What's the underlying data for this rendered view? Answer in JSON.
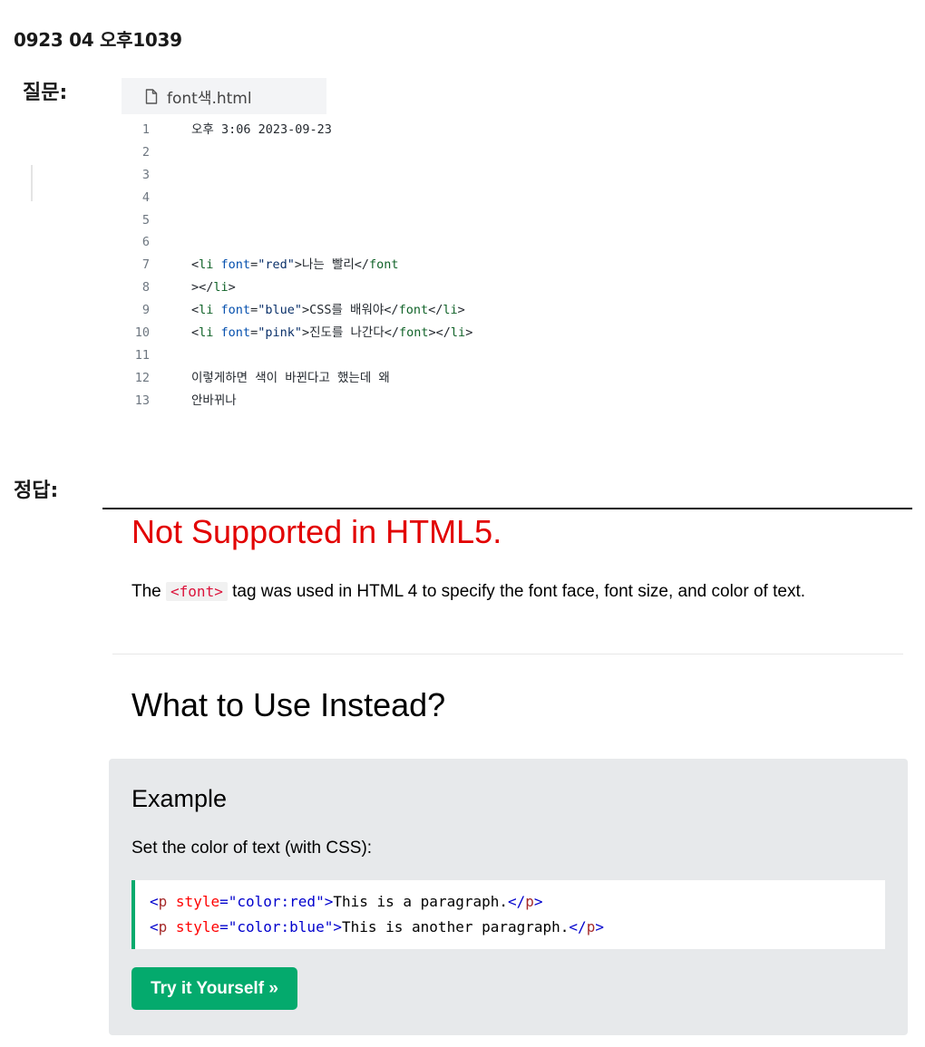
{
  "header": {
    "title": "0923 04 오후1039"
  },
  "question": {
    "label": "질문:"
  },
  "answer": {
    "label": "정답:"
  },
  "file": {
    "icon": "file-icon",
    "name": "font색.html",
    "lines": [
      {
        "num": "1",
        "tokens": [
          {
            "t": "txt",
            "v": "오후 3:06 2023-09-23"
          }
        ]
      },
      {
        "num": "2",
        "tokens": []
      },
      {
        "num": "3",
        "tokens": []
      },
      {
        "num": "4",
        "tokens": []
      },
      {
        "num": "5",
        "tokens": []
      },
      {
        "num": "6",
        "tokens": []
      },
      {
        "num": "7",
        "tokens": [
          {
            "t": "txt",
            "v": "<"
          },
          {
            "t": "tag",
            "v": "li"
          },
          {
            "t": "txt",
            "v": " "
          },
          {
            "t": "attr",
            "v": "font"
          },
          {
            "t": "txt",
            "v": "="
          },
          {
            "t": "str",
            "v": "\"red\""
          },
          {
            "t": "txt",
            "v": ">나는 빨리</"
          },
          {
            "t": "tag",
            "v": "font"
          }
        ]
      },
      {
        "num": "8",
        "tokens": [
          {
            "t": "txt",
            "v": "></"
          },
          {
            "t": "tag",
            "v": "li"
          },
          {
            "t": "txt",
            "v": ">"
          }
        ]
      },
      {
        "num": "9",
        "tokens": [
          {
            "t": "txt",
            "v": "<"
          },
          {
            "t": "tag",
            "v": "li"
          },
          {
            "t": "txt",
            "v": " "
          },
          {
            "t": "attr",
            "v": "font"
          },
          {
            "t": "txt",
            "v": "="
          },
          {
            "t": "str",
            "v": "\"blue\""
          },
          {
            "t": "txt",
            "v": ">CSS를 배워야</"
          },
          {
            "t": "tag",
            "v": "font"
          },
          {
            "t": "txt",
            "v": "</"
          },
          {
            "t": "tag",
            "v": "li"
          },
          {
            "t": "txt",
            "v": ">"
          }
        ]
      },
      {
        "num": "10",
        "tokens": [
          {
            "t": "txt",
            "v": "<"
          },
          {
            "t": "tag",
            "v": "li"
          },
          {
            "t": "txt",
            "v": " "
          },
          {
            "t": "attr",
            "v": "font"
          },
          {
            "t": "txt",
            "v": "="
          },
          {
            "t": "str",
            "v": "\"pink\""
          },
          {
            "t": "txt",
            "v": ">진도를 나간다</"
          },
          {
            "t": "tag",
            "v": "font"
          },
          {
            "t": "txt",
            "v": "></"
          },
          {
            "t": "tag",
            "v": "li"
          },
          {
            "t": "txt",
            "v": ">"
          }
        ]
      },
      {
        "num": "11",
        "tokens": []
      },
      {
        "num": "12",
        "tokens": [
          {
            "t": "txt",
            "v": "이렇게하면 색이 바뀐다고 했는데 왜"
          }
        ]
      },
      {
        "num": "13",
        "tokens": [
          {
            "t": "txt",
            "v": "안바뀌나"
          }
        ]
      }
    ]
  },
  "w3": {
    "not_supported": "Not Supported in HTML5.",
    "intro_before": "The ",
    "intro_code": "<font>",
    "intro_after": " tag was used in HTML 4 to specify the font face, font size, and color of text.",
    "instead_title": "What to Use Instead?",
    "example_title": "Example",
    "example_desc": "Set the color of text (with CSS):",
    "code_lines": [
      {
        "tag": "p",
        "attr": "style",
        "value": "\"color:red\"",
        "text": "This is a paragraph."
      },
      {
        "tag": "p",
        "attr": "style",
        "value": "\"color:blue\"",
        "text": "This is another paragraph."
      }
    ],
    "try_button": "Try it Yourself »"
  },
  "colors": {
    "not_supported": "#e20000",
    "accent": "#04aa6d",
    "example_bg": "#e7e9eb",
    "inline_code": "#dc143c"
  }
}
